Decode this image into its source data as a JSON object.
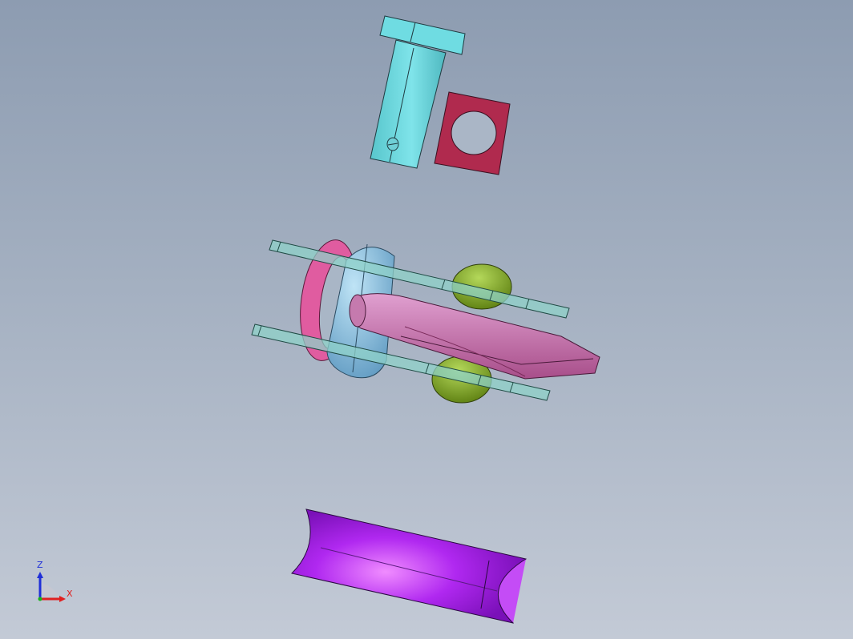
{
  "triad": {
    "z_label": "Z",
    "x_label": "X",
    "z_color": "#1f2fd8",
    "x_color": "#e02020",
    "origin_color": "#18b418"
  },
  "parts": [
    {
      "name": "clevis-pin",
      "color": "#5fd2d8"
    },
    {
      "name": "square-washer",
      "color": "#b02a4e"
    },
    {
      "name": "side-plates",
      "color": "#8fd1c8"
    },
    {
      "name": "ring",
      "color": "#e05ca0"
    },
    {
      "name": "roller-pin",
      "color": "#7ab4dc"
    },
    {
      "name": "spherical-bearing",
      "color": "#7aa018"
    },
    {
      "name": "tapered-link",
      "color": "#c76aa8"
    },
    {
      "name": "saddle-sleeve",
      "color": "#a020e8"
    }
  ]
}
